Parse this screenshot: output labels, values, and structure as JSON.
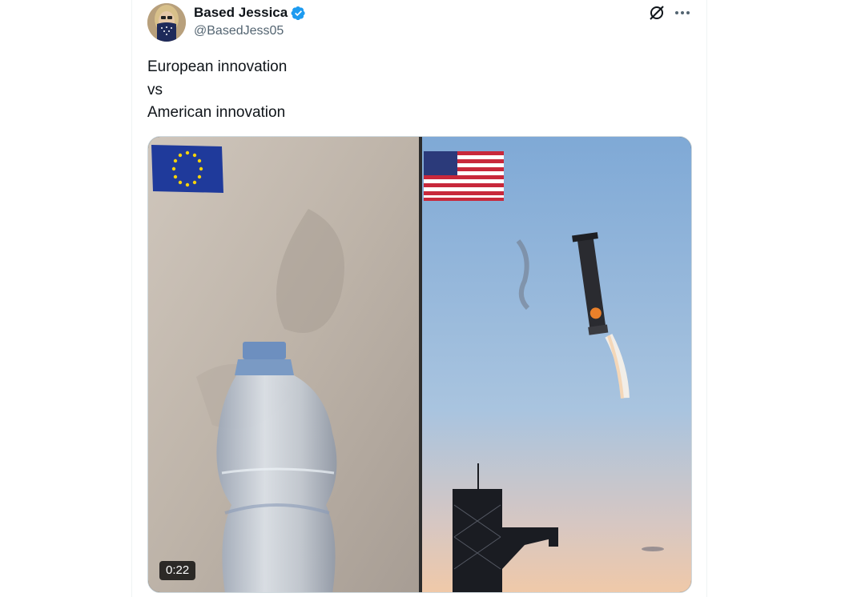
{
  "tweet": {
    "author": {
      "display_name": "Based Jessica",
      "handle": "@BasedJess05",
      "verified": true
    },
    "text_lines": [
      "European innovation",
      "vs",
      "American innovation"
    ],
    "media": {
      "type": "video",
      "duration": "0:22",
      "left_panel": "eu-flag-water-bottle",
      "right_panel": "us-flag-rocket-booster"
    },
    "actions": {
      "grok_icon": "grok-icon",
      "more_icon": "more-icon"
    }
  },
  "colors": {
    "verified_blue": "#1d9bf0",
    "text": "#0f1419",
    "secondary": "#536471"
  }
}
